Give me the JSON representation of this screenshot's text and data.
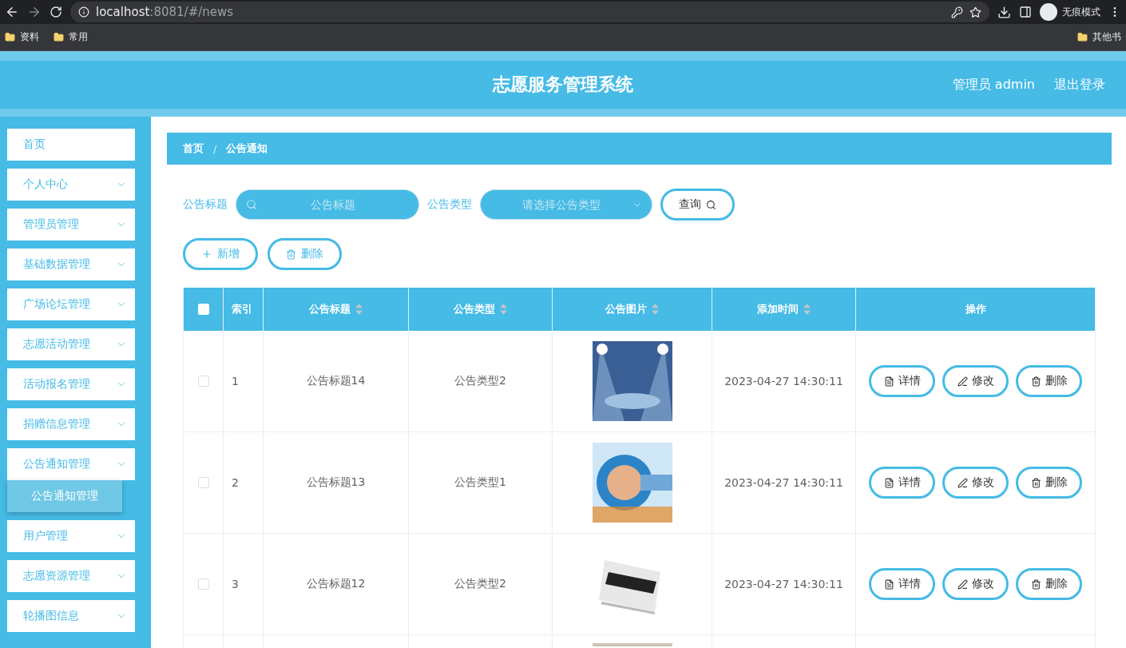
{
  "browser": {
    "url_host": "localhost",
    "url_rest": ":8081/#/news",
    "incognito_label": "无痕模式",
    "bookmarks": [
      "资料",
      "常用"
    ],
    "other_bookmarks": "其他书"
  },
  "header": {
    "title": "志愿服务管理系统",
    "user": "管理员 admin",
    "logout": "退出登录"
  },
  "sidebar": {
    "items": [
      {
        "label": "首页",
        "kind": "link"
      },
      {
        "label": "个人中心",
        "kind": "menu"
      },
      {
        "label": "管理员管理",
        "kind": "menu"
      },
      {
        "label": "基础数据管理",
        "kind": "menu"
      },
      {
        "label": "广场论坛管理",
        "kind": "menu"
      },
      {
        "label": "志愿活动管理",
        "kind": "menu"
      },
      {
        "label": "活动报名管理",
        "kind": "menu"
      },
      {
        "label": "捐赠信息管理",
        "kind": "menu"
      },
      {
        "label": "公告通知管理",
        "kind": "menu",
        "children": [
          {
            "label": "公告通知管理",
            "selected": true
          }
        ]
      },
      {
        "label": "用户管理",
        "kind": "menu"
      },
      {
        "label": "志愿资源管理",
        "kind": "menu"
      },
      {
        "label": "轮播图信息",
        "kind": "menu"
      }
    ]
  },
  "breadcrumb": [
    "首页",
    "公告通知"
  ],
  "breadcrumb_separator": "/",
  "filters": [
    {
      "label": "公告标题",
      "kind": "search",
      "placeholder": "公告标题"
    },
    {
      "label": "公告类型",
      "kind": "select",
      "placeholder": "请选择公告类型"
    }
  ],
  "query_button": "查询",
  "actions": [
    {
      "label": "新增",
      "kind": "add"
    },
    {
      "label": "删除",
      "kind": "delete"
    }
  ],
  "table": {
    "select_all_checked": false,
    "columns": [
      {
        "label": "索引",
        "kind": "plain"
      },
      {
        "label": "公告标题",
        "kind": "sortable"
      },
      {
        "label": "公告类型",
        "kind": "sortable"
      },
      {
        "label": "公告图片",
        "kind": "sortable"
      },
      {
        "label": "添加时间",
        "kind": "sortable"
      },
      {
        "label": "操作",
        "kind": "plain"
      }
    ],
    "rows": [
      {
        "checked": false,
        "index": "1",
        "title": "公告标题14",
        "type": "公告类型2",
        "picture": {
          "kind": "picture"
        },
        "time": "2023-04-27 14:30:11",
        "buttons": [
          {
            "label": "详情",
            "kind": "detail"
          },
          {
            "label": "修改",
            "kind": "edit"
          },
          {
            "label": "删除",
            "kind": "delete"
          }
        ]
      },
      {
        "checked": false,
        "index": "2",
        "title": "公告标题13",
        "type": "公告类型1",
        "picture": {
          "kind": "picture"
        },
        "time": "2023-04-27 14:30:11",
        "buttons": [
          {
            "label": "详情",
            "kind": "detail"
          },
          {
            "label": "修改",
            "kind": "edit"
          },
          {
            "label": "删除",
            "kind": "delete"
          }
        ]
      },
      {
        "checked": false,
        "index": "3",
        "title": "公告标题12",
        "type": "公告类型2",
        "picture": {
          "kind": "picture"
        },
        "time": "2023-04-27 14:30:11",
        "buttons": [
          {
            "label": "详情",
            "kind": "detail"
          },
          {
            "label": "修改",
            "kind": "edit"
          },
          {
            "label": "删除",
            "kind": "delete"
          }
        ]
      },
      {
        "picture": {
          "kind": "picture"
        }
      }
    ]
  }
}
